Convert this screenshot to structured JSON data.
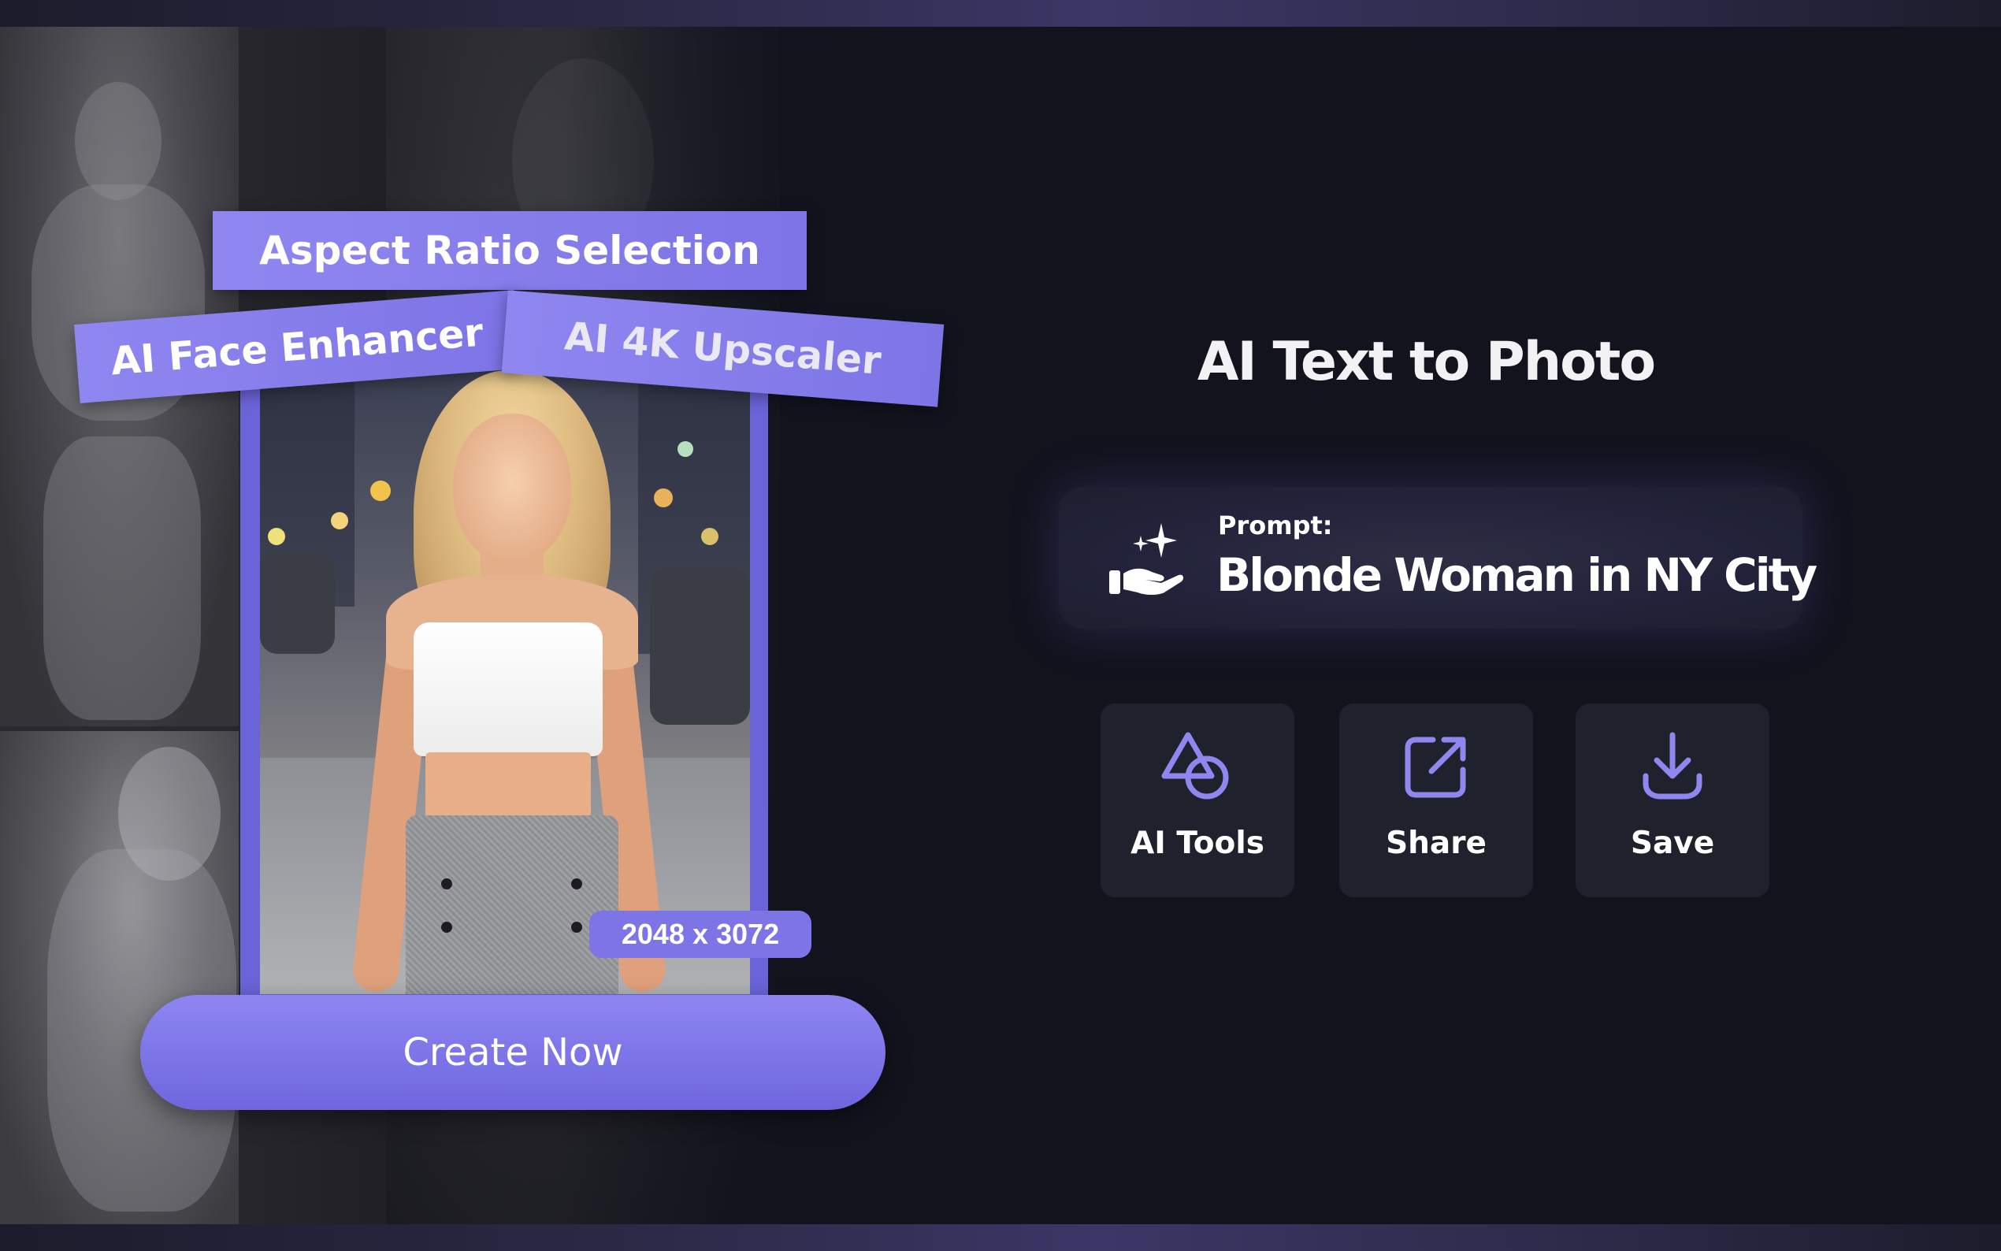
{
  "tags": {
    "aspect": "Aspect Ratio Selection",
    "face": "AI Face Enhancer",
    "upscaler": "AI 4K Upscaler"
  },
  "photo": {
    "size_badge": "2048 x 3072"
  },
  "cta": {
    "label": "Create Now"
  },
  "feature": {
    "title": "AI Text to Photo",
    "prompt_label": "Prompt:",
    "prompt_text": "Blonde Woman in NY City",
    "prompt_icon": "sparkle-hand-icon"
  },
  "tools": [
    {
      "label": "AI Tools",
      "icon": "shapes-icon"
    },
    {
      "label": "Share",
      "icon": "share-icon"
    },
    {
      "label": "Save",
      "icon": "download-icon"
    }
  ],
  "colors": {
    "accent": "#7d74e6",
    "background": "#12131d",
    "tool_card": "#1f222d"
  }
}
